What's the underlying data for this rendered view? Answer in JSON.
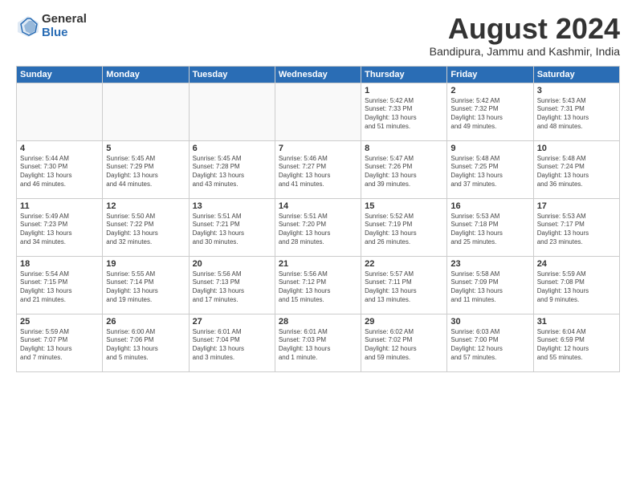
{
  "header": {
    "logo_general": "General",
    "logo_blue": "Blue",
    "month_title": "August 2024",
    "location": "Bandipura, Jammu and Kashmir, India"
  },
  "weekdays": [
    "Sunday",
    "Monday",
    "Tuesday",
    "Wednesday",
    "Thursday",
    "Friday",
    "Saturday"
  ],
  "weeks": [
    [
      {
        "day": "",
        "info": ""
      },
      {
        "day": "",
        "info": ""
      },
      {
        "day": "",
        "info": ""
      },
      {
        "day": "",
        "info": ""
      },
      {
        "day": "1",
        "info": "Sunrise: 5:42 AM\nSunset: 7:33 PM\nDaylight: 13 hours\nand 51 minutes."
      },
      {
        "day": "2",
        "info": "Sunrise: 5:42 AM\nSunset: 7:32 PM\nDaylight: 13 hours\nand 49 minutes."
      },
      {
        "day": "3",
        "info": "Sunrise: 5:43 AM\nSunset: 7:31 PM\nDaylight: 13 hours\nand 48 minutes."
      }
    ],
    [
      {
        "day": "4",
        "info": "Sunrise: 5:44 AM\nSunset: 7:30 PM\nDaylight: 13 hours\nand 46 minutes."
      },
      {
        "day": "5",
        "info": "Sunrise: 5:45 AM\nSunset: 7:29 PM\nDaylight: 13 hours\nand 44 minutes."
      },
      {
        "day": "6",
        "info": "Sunrise: 5:45 AM\nSunset: 7:28 PM\nDaylight: 13 hours\nand 43 minutes."
      },
      {
        "day": "7",
        "info": "Sunrise: 5:46 AM\nSunset: 7:27 PM\nDaylight: 13 hours\nand 41 minutes."
      },
      {
        "day": "8",
        "info": "Sunrise: 5:47 AM\nSunset: 7:26 PM\nDaylight: 13 hours\nand 39 minutes."
      },
      {
        "day": "9",
        "info": "Sunrise: 5:48 AM\nSunset: 7:25 PM\nDaylight: 13 hours\nand 37 minutes."
      },
      {
        "day": "10",
        "info": "Sunrise: 5:48 AM\nSunset: 7:24 PM\nDaylight: 13 hours\nand 36 minutes."
      }
    ],
    [
      {
        "day": "11",
        "info": "Sunrise: 5:49 AM\nSunset: 7:23 PM\nDaylight: 13 hours\nand 34 minutes."
      },
      {
        "day": "12",
        "info": "Sunrise: 5:50 AM\nSunset: 7:22 PM\nDaylight: 13 hours\nand 32 minutes."
      },
      {
        "day": "13",
        "info": "Sunrise: 5:51 AM\nSunset: 7:21 PM\nDaylight: 13 hours\nand 30 minutes."
      },
      {
        "day": "14",
        "info": "Sunrise: 5:51 AM\nSunset: 7:20 PM\nDaylight: 13 hours\nand 28 minutes."
      },
      {
        "day": "15",
        "info": "Sunrise: 5:52 AM\nSunset: 7:19 PM\nDaylight: 13 hours\nand 26 minutes."
      },
      {
        "day": "16",
        "info": "Sunrise: 5:53 AM\nSunset: 7:18 PM\nDaylight: 13 hours\nand 25 minutes."
      },
      {
        "day": "17",
        "info": "Sunrise: 5:53 AM\nSunset: 7:17 PM\nDaylight: 13 hours\nand 23 minutes."
      }
    ],
    [
      {
        "day": "18",
        "info": "Sunrise: 5:54 AM\nSunset: 7:15 PM\nDaylight: 13 hours\nand 21 minutes."
      },
      {
        "day": "19",
        "info": "Sunrise: 5:55 AM\nSunset: 7:14 PM\nDaylight: 13 hours\nand 19 minutes."
      },
      {
        "day": "20",
        "info": "Sunrise: 5:56 AM\nSunset: 7:13 PM\nDaylight: 13 hours\nand 17 minutes."
      },
      {
        "day": "21",
        "info": "Sunrise: 5:56 AM\nSunset: 7:12 PM\nDaylight: 13 hours\nand 15 minutes."
      },
      {
        "day": "22",
        "info": "Sunrise: 5:57 AM\nSunset: 7:11 PM\nDaylight: 13 hours\nand 13 minutes."
      },
      {
        "day": "23",
        "info": "Sunrise: 5:58 AM\nSunset: 7:09 PM\nDaylight: 13 hours\nand 11 minutes."
      },
      {
        "day": "24",
        "info": "Sunrise: 5:59 AM\nSunset: 7:08 PM\nDaylight: 13 hours\nand 9 minutes."
      }
    ],
    [
      {
        "day": "25",
        "info": "Sunrise: 5:59 AM\nSunset: 7:07 PM\nDaylight: 13 hours\nand 7 minutes."
      },
      {
        "day": "26",
        "info": "Sunrise: 6:00 AM\nSunset: 7:06 PM\nDaylight: 13 hours\nand 5 minutes."
      },
      {
        "day": "27",
        "info": "Sunrise: 6:01 AM\nSunset: 7:04 PM\nDaylight: 13 hours\nand 3 minutes."
      },
      {
        "day": "28",
        "info": "Sunrise: 6:01 AM\nSunset: 7:03 PM\nDaylight: 13 hours\nand 1 minute."
      },
      {
        "day": "29",
        "info": "Sunrise: 6:02 AM\nSunset: 7:02 PM\nDaylight: 12 hours\nand 59 minutes."
      },
      {
        "day": "30",
        "info": "Sunrise: 6:03 AM\nSunset: 7:00 PM\nDaylight: 12 hours\nand 57 minutes."
      },
      {
        "day": "31",
        "info": "Sunrise: 6:04 AM\nSunset: 6:59 PM\nDaylight: 12 hours\nand 55 minutes."
      }
    ]
  ]
}
